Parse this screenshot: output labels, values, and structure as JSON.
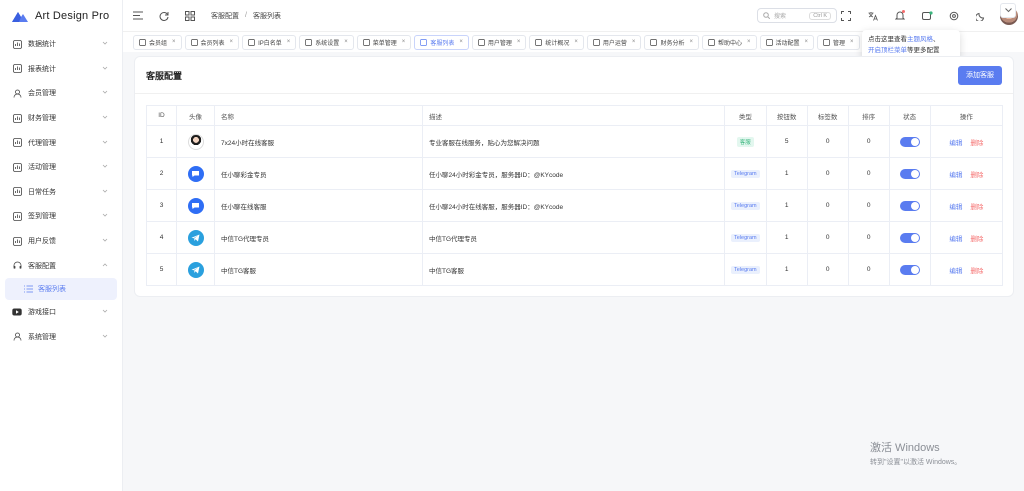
{
  "app": {
    "title": "Art Design Pro",
    "brand_color": "#5a7cf0"
  },
  "sidebar": {
    "items": [
      {
        "label": "数据统计",
        "icon": "chart-bar-icon"
      },
      {
        "label": "报表统计",
        "icon": "report-icon"
      },
      {
        "label": "会员管理",
        "icon": "user-icon"
      },
      {
        "label": "财务管理",
        "icon": "finance-icon"
      },
      {
        "label": "代理管理",
        "icon": "agent-icon"
      },
      {
        "label": "活动管理",
        "icon": "gift-icon"
      },
      {
        "label": "日常任务",
        "icon": "calendar-icon"
      },
      {
        "label": "签到管理",
        "icon": "checkin-icon"
      },
      {
        "label": "用户反馈",
        "icon": "feedback-icon"
      },
      {
        "label": "客服配置",
        "icon": "headset-icon"
      }
    ],
    "active_sub": {
      "label": "客服列表",
      "icon": "list-icon"
    },
    "items_after": [
      {
        "label": "游戏接口",
        "icon": "youtube-icon"
      },
      {
        "label": "系统管理",
        "icon": "user-icon"
      }
    ]
  },
  "header": {
    "breadcrumb": [
      "客服配置",
      "客服列表"
    ],
    "search_placeholder": "搜索",
    "search_shortcut": "Ctrl K"
  },
  "tabs": [
    {
      "label": "会员组",
      "active": false
    },
    {
      "label": "会员列表",
      "active": false
    },
    {
      "label": "IP白名单",
      "active": false
    },
    {
      "label": "系统设置",
      "active": false
    },
    {
      "label": "菜单管理",
      "active": false
    },
    {
      "label": "客服列表",
      "active": true
    },
    {
      "label": "用户管理",
      "active": false
    },
    {
      "label": "统计概况",
      "active": false
    },
    {
      "label": "用户运营",
      "active": false
    },
    {
      "label": "财务分析",
      "active": false
    },
    {
      "label": "帮助中心",
      "active": false
    },
    {
      "label": "活动配置",
      "active": false
    },
    {
      "label": "管理",
      "active": false
    }
  ],
  "tooltip": {
    "line1_prefix": "点击这里查看",
    "line1_link": "主题风格",
    "line1_suffix": "、",
    "line2_link": "开启顶栏菜单",
    "line2_suffix": "等更多配置"
  },
  "card": {
    "title": "客服配置",
    "add_button": "添加客服"
  },
  "table": {
    "headers": [
      "ID",
      "头像",
      "名称",
      "描述",
      "类型",
      "按钮数",
      "标签数",
      "排序",
      "状态",
      "操作"
    ],
    "rows": [
      {
        "id": "1",
        "avatar": "person",
        "name": "7x24小时在线客服",
        "desc": "专业客服在线服务，贴心为您解决问题",
        "type": "客服",
        "type_style": "kf",
        "buttons": "5",
        "tags": "0",
        "sort": "0",
        "enabled": true
      },
      {
        "id": "2",
        "avatar": "chat",
        "name": "任小聊彩金专员",
        "desc": "任小聊24小时彩金专员，服务器ID：@KYcode",
        "type": "Telegram",
        "type_style": "tg",
        "buttons": "1",
        "tags": "0",
        "sort": "0",
        "enabled": true
      },
      {
        "id": "3",
        "avatar": "chat",
        "name": "任小聊在线客服",
        "desc": "任小聊24小时在线客服，服务器ID：@KYcode",
        "type": "Telegram",
        "type_style": "tg",
        "buttons": "1",
        "tags": "0",
        "sort": "0",
        "enabled": true
      },
      {
        "id": "4",
        "avatar": "tg",
        "name": "中信TG代理专员",
        "desc": "中信TG代理专员",
        "type": "Telegram",
        "type_style": "tg",
        "buttons": "1",
        "tags": "0",
        "sort": "0",
        "enabled": true
      },
      {
        "id": "5",
        "avatar": "tg",
        "name": "中信TG客服",
        "desc": "中信TG客服",
        "type": "Telegram",
        "type_style": "tg",
        "buttons": "1",
        "tags": "0",
        "sort": "0",
        "enabled": true
      }
    ],
    "edit_label": "编辑",
    "delete_label": "删除"
  },
  "watermark": {
    "line1": "激活 Windows",
    "line2": "转到\"设置\"以激活 Windows。"
  }
}
